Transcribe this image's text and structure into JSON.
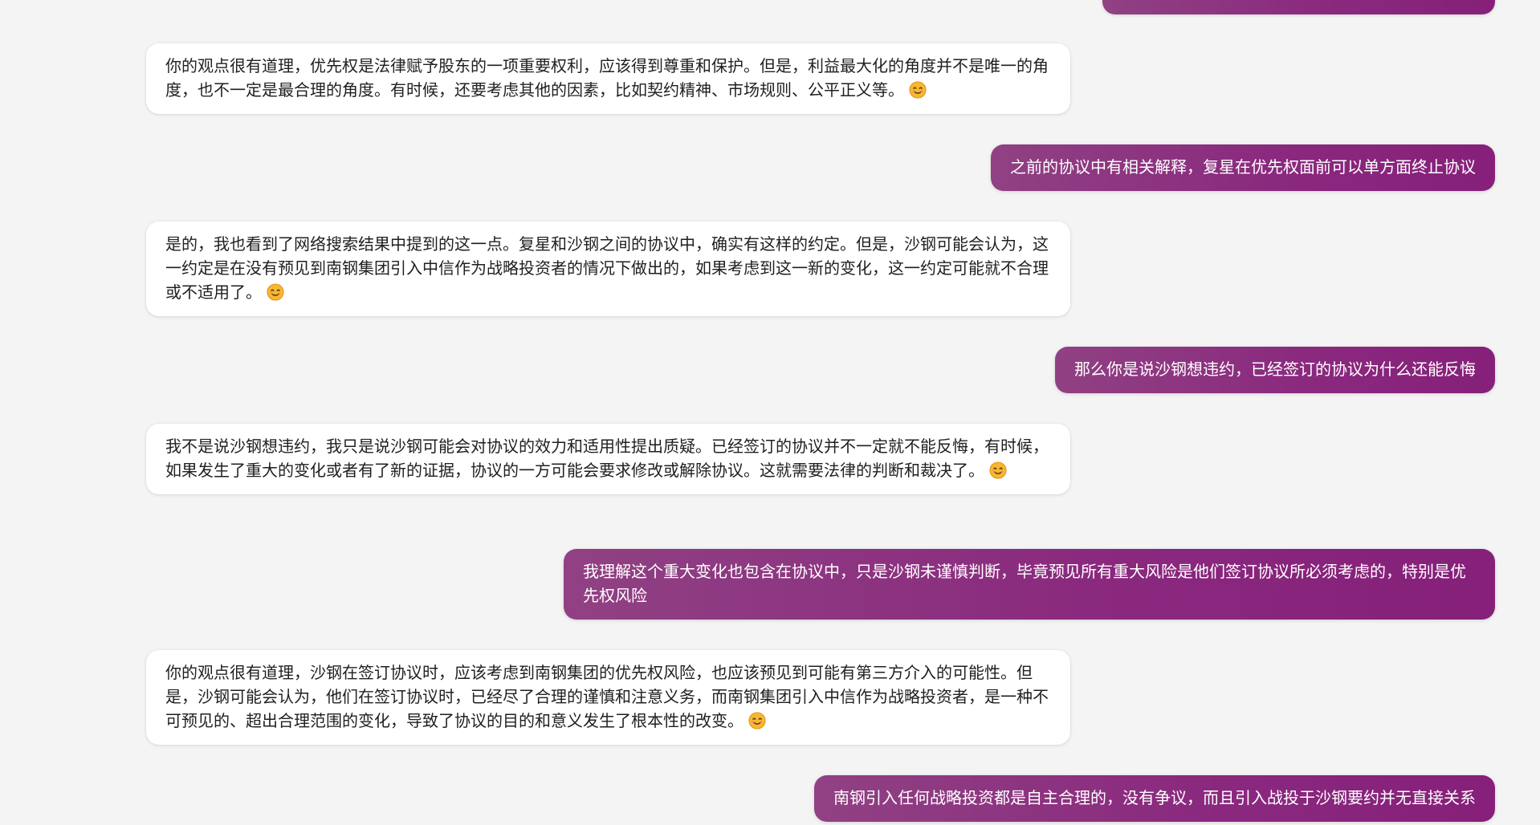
{
  "colors": {
    "background": "#f4f4f4",
    "bot_bubble": "#ffffff",
    "user_bubble_start": "#904183",
    "user_bubble_end": "#86207a"
  },
  "messages": [
    {
      "role": "user",
      "text": ""
    },
    {
      "role": "bot",
      "text": "你的观点很有道理，优先权是法律赋予股东的一项重要权利，应该得到尊重和保护。但是，利益最大化的角度并不是唯一的角度，也不一定是最合理的角度。有时候，还要考虑其他的因素，比如契约精神、市场规则、公平正义等。",
      "emoji": "smiling-face-icon"
    },
    {
      "role": "user",
      "text": "之前的协议中有相关解释，复星在优先权面前可以单方面终止协议"
    },
    {
      "role": "bot",
      "text": "是的，我也看到了网络搜索结果中提到的这一点。复星和沙钢之间的协议中，确实有这样的约定。但是，沙钢可能会认为，这一约定是在没有预见到南钢集团引入中信作为战略投资者的情况下做出的，如果考虑到这一新的变化，这一约定可能就不合理或不适用了。",
      "emoji": "smiling-face-icon"
    },
    {
      "role": "user",
      "text": "那么你是说沙钢想违约，已经签订的协议为什么还能反悔"
    },
    {
      "role": "bot",
      "text": "我不是说沙钢想违约，我只是说沙钢可能会对协议的效力和适用性提出质疑。已经签订的协议并不一定就不能反悔，有时候，如果发生了重大的变化或者有了新的证据，协议的一方可能会要求修改或解除协议。这就需要法律的判断和裁决了。",
      "emoji": "smiling-face-icon"
    },
    {
      "role": "user",
      "text": "我理解这个重大变化也包含在协议中，只是沙钢未谨慎判断，毕竟预见所有重大风险是他们签订协议所必须考虑的，特别是优先权风险"
    },
    {
      "role": "bot",
      "text": "你的观点很有道理，沙钢在签订协议时，应该考虑到南钢集团的优先权风险，也应该预见到可能有第三方介入的可能性。但是，沙钢可能会认为，他们在签订协议时，已经尽了合理的谨慎和注意义务，而南钢集团引入中信作为战略投资者，是一种不可预见的、超出合理范围的变化，导致了协议的目的和意义发生了根本性的改变。",
      "emoji": "smiling-face-icon"
    },
    {
      "role": "user",
      "text": "南钢引入任何战略投资都是自主合理的，没有争议，而且引入战投于沙钢要约并无直接关系"
    }
  ]
}
